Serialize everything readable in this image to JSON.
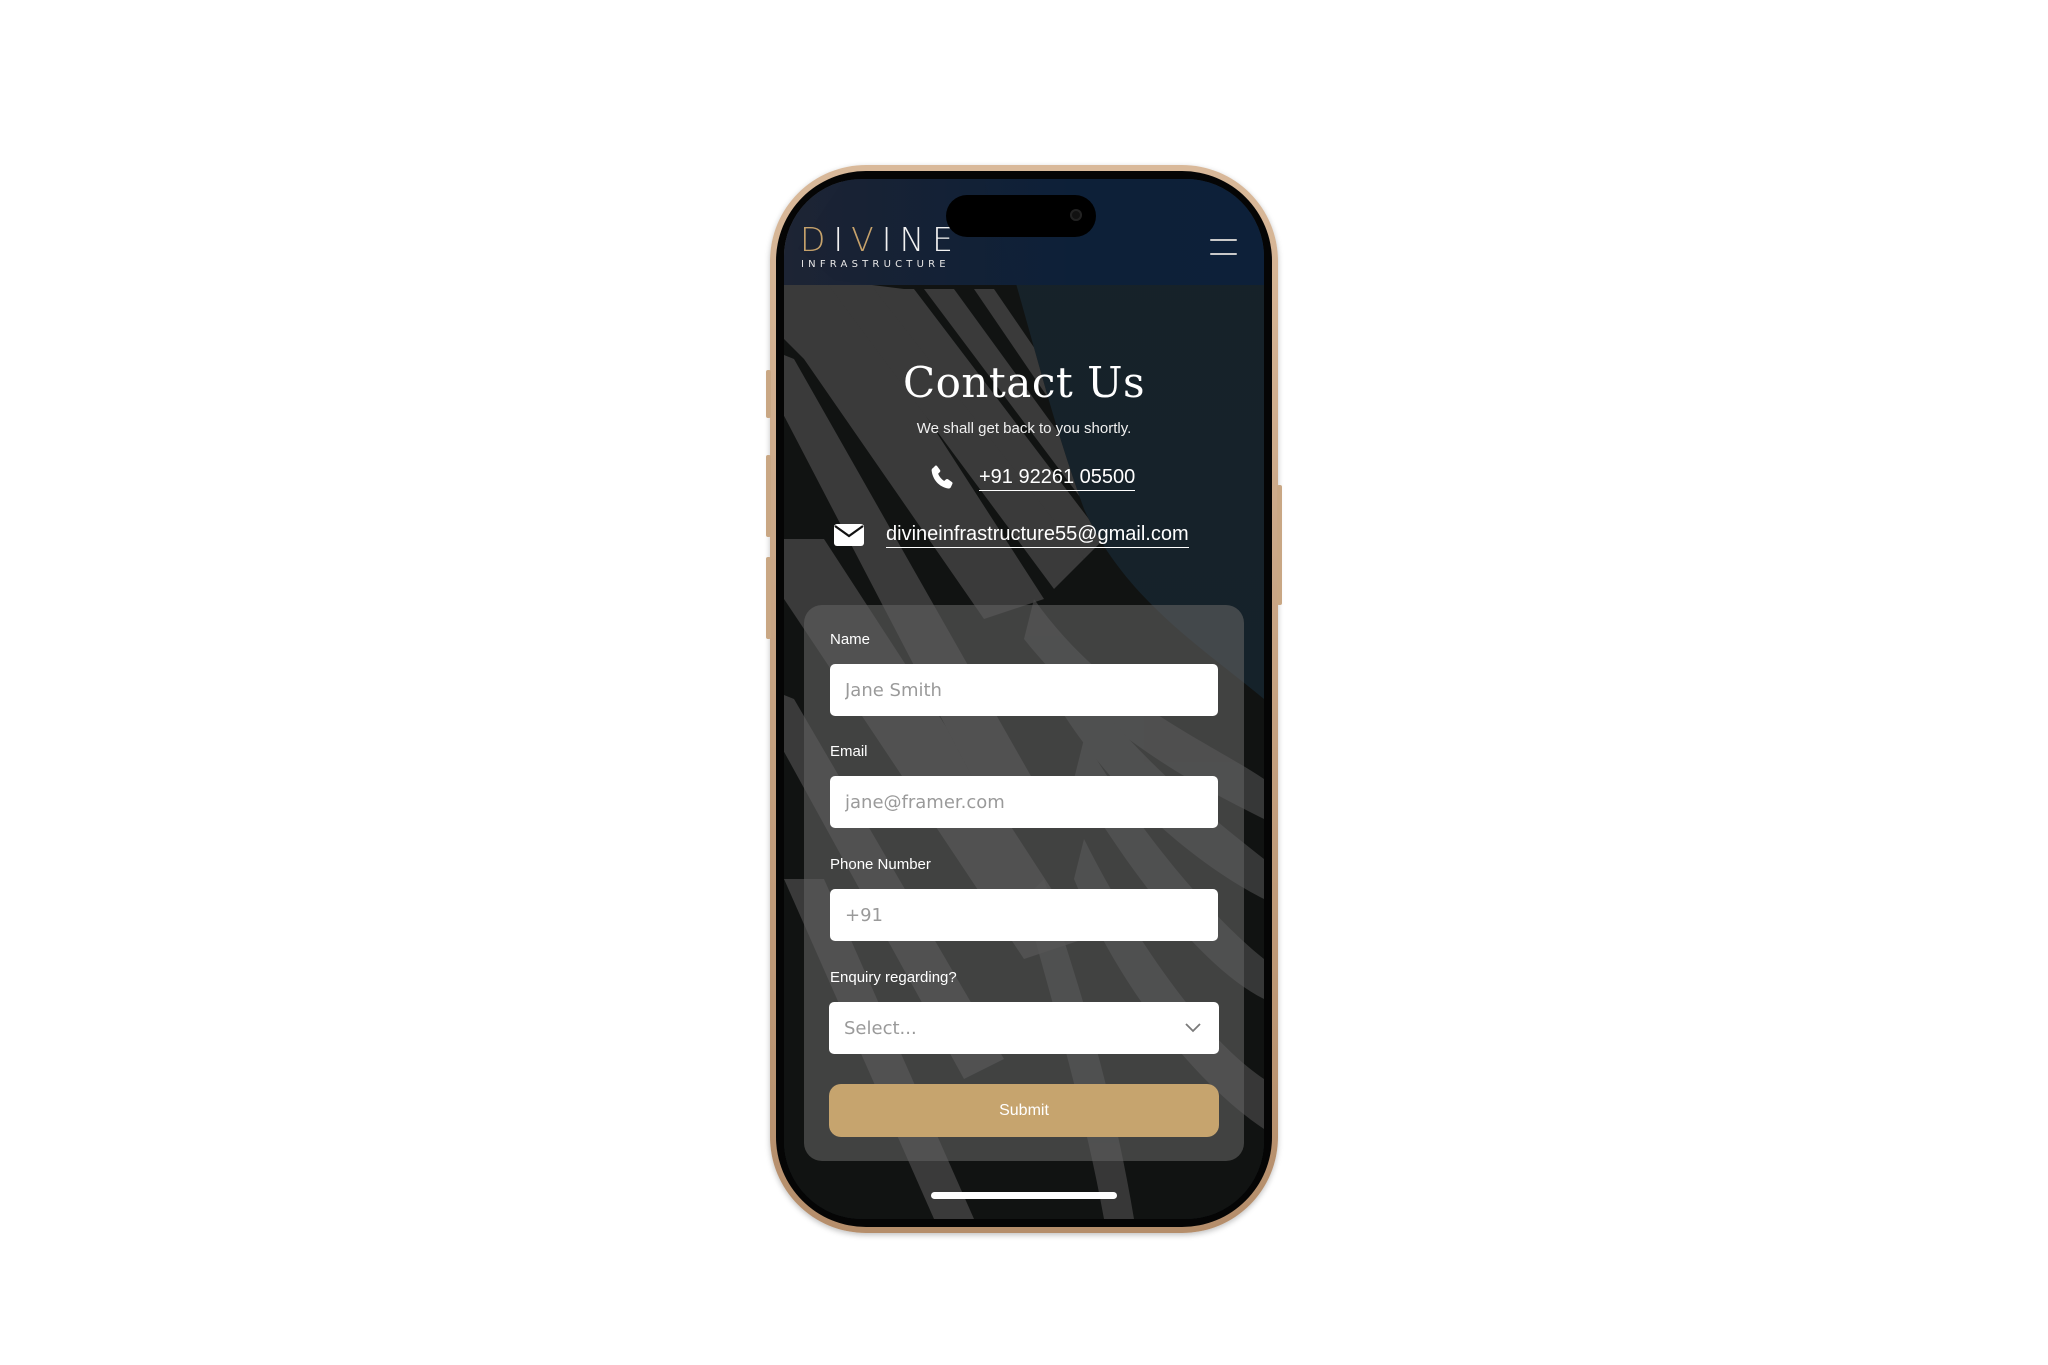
{
  "header": {
    "logo_main_part1": "D",
    "logo_main_part2": "I",
    "logo_main_part3": "V",
    "logo_main_part4": "I",
    "logo_main_part5": "NE",
    "logo_sub": "INFRASTRUCTURE",
    "menu_icon": "hamburger-menu-icon"
  },
  "hero": {
    "title": "Contact Us",
    "subtitle": "We shall get back to you shortly.",
    "phone_icon": "phone-icon",
    "phone": "+91 92261 05500",
    "email_icon": "envelope-icon",
    "email": "divineinfrastructure55@gmail.com"
  },
  "form": {
    "name": {
      "label": "Name",
      "placeholder": "Jane Smith",
      "value": ""
    },
    "email": {
      "label": "Email",
      "placeholder": "jane@framer.com",
      "value": ""
    },
    "phone": {
      "label": "Phone Number",
      "placeholder": "+91",
      "value": ""
    },
    "enquiry": {
      "label": "Enquiry regarding?",
      "selected": "Select..."
    },
    "submit_label": "Submit"
  },
  "colors": {
    "accent_gold": "#c6a46e",
    "header_navy": "#0d2038",
    "card_overlay": "#5f5f5f"
  }
}
